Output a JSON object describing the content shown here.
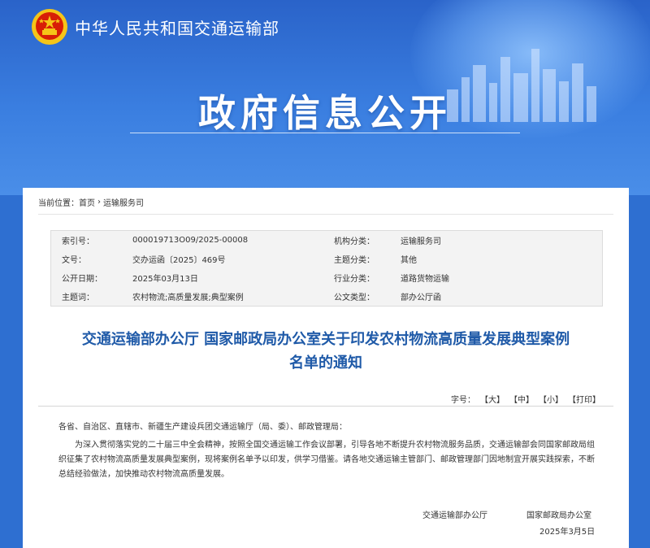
{
  "site": {
    "name": "中华人民共和国交通运输部"
  },
  "section": {
    "title": "政府信息公开"
  },
  "breadcrumb": {
    "prefix": "当前位置：",
    "home": "首页",
    "sep": "›",
    "current": "运输服务司"
  },
  "meta": {
    "rows": [
      {
        "k1": "索引号：",
        "v1": "000019713O09/2025-00008",
        "k2": "机构分类：",
        "v2": "运输服务司"
      },
      {
        "k1": "文号：",
        "v1": "交办运函〔2025〕469号",
        "k2": "主题分类：",
        "v2": "其他"
      },
      {
        "k1": "公开日期：",
        "v1": "2025年03月13日",
        "k2": "行业分类：",
        "v2": "道路货物运输"
      },
      {
        "k1": "主题词：",
        "v1": "农村物流;高质量发展;典型案例",
        "k2": "公文类型：",
        "v2": "部办公厅函"
      }
    ]
  },
  "article": {
    "title_line1": "交通运输部办公厅 国家邮政局办公室关于印发农村物流高质量发展典型案例",
    "title_line2": "名单的通知",
    "font_size_label": "字号：",
    "font_large": "【大】",
    "font_medium": "【中】",
    "font_small": "【小】",
    "print": "【打印】",
    "addressee": "各省、自治区、直辖市、新疆生产建设兵团交通运输厅（局、委）、邮政管理局：",
    "paragraph": "为深入贯彻落实党的二十届三中全会精神，按照全国交通运输工作会议部署，引导各地不断提升农村物流服务品质，交通运输部会同国家邮政局组织征集了农村物流高质量发展典型案例，现将案例名单予以印发，供学习借鉴。请各地交通运输主管部门、邮政管理部门因地制宜开展实践探索，不断总结经验做法，加快推动农村物流高质量发展。",
    "signer_left": "交通运输部办公厅",
    "signer_right": "国家邮政局办公室",
    "date": "2025年3月5日"
  },
  "colors": {
    "banner": "#2e6fd1",
    "title": "#1f5aa8",
    "emblem_red": "#d81e06",
    "emblem_gold": "#f5c518"
  }
}
